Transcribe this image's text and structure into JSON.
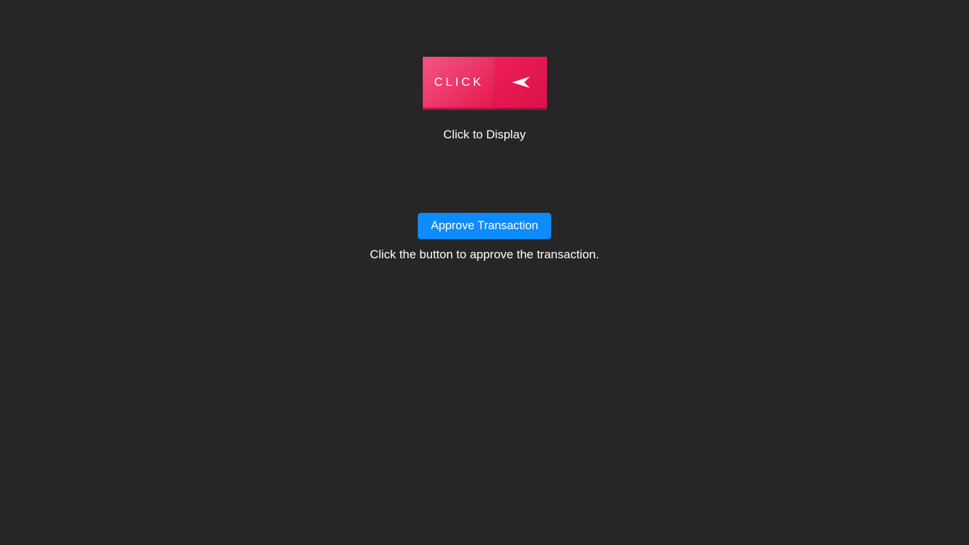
{
  "click_section": {
    "button_label": "CLICK",
    "icon_name": "send-arrow-icon",
    "description": "Click to Display"
  },
  "approve_section": {
    "button_label": "Approve Transaction",
    "description": "Click the button to approve the transaction."
  },
  "colors": {
    "background": "#262626",
    "pink_light": "#f55584",
    "pink_dark": "#e6174e",
    "pink_darker": "#d9134a",
    "blue": "#0d8bff"
  }
}
